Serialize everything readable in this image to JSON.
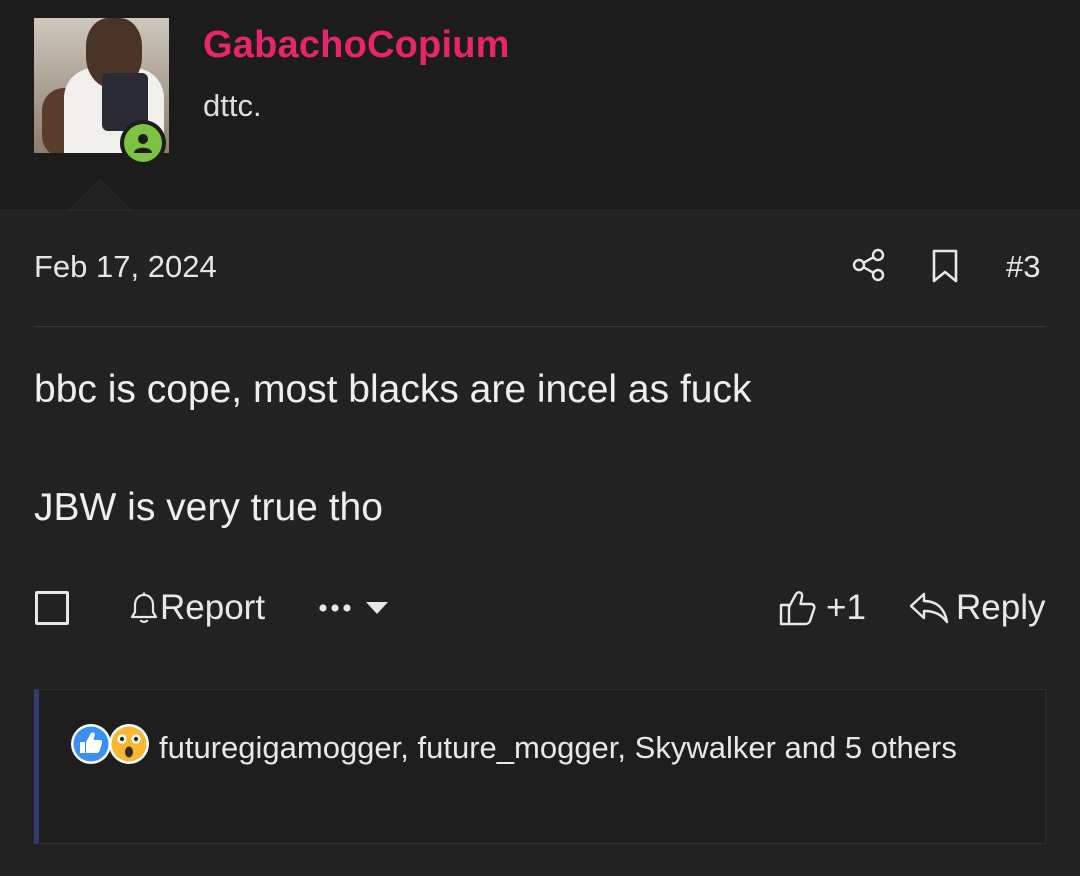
{
  "user": {
    "name": "GabachoCopium",
    "title": "dttc.",
    "name_color": "#e8246b",
    "online_color": "#7cc243"
  },
  "post": {
    "date": "Feb 17, 2024",
    "number": "#3",
    "lines": [
      "bbc is cope, most blacks are incel as fuck",
      "JBW is very true tho"
    ]
  },
  "actions": {
    "report_label": "Report",
    "like_label": "+1",
    "reply_label": "Reply"
  },
  "reactions": {
    "icons": [
      "like-reaction-icon",
      "shocked-face-reaction-icon"
    ],
    "text": "futuregigamogger, future_mogger, Skywalker and 5 others"
  },
  "colors": {
    "background": "#222222",
    "header_background": "#1c1c1c",
    "reactions_accent": "#2f3d73"
  }
}
